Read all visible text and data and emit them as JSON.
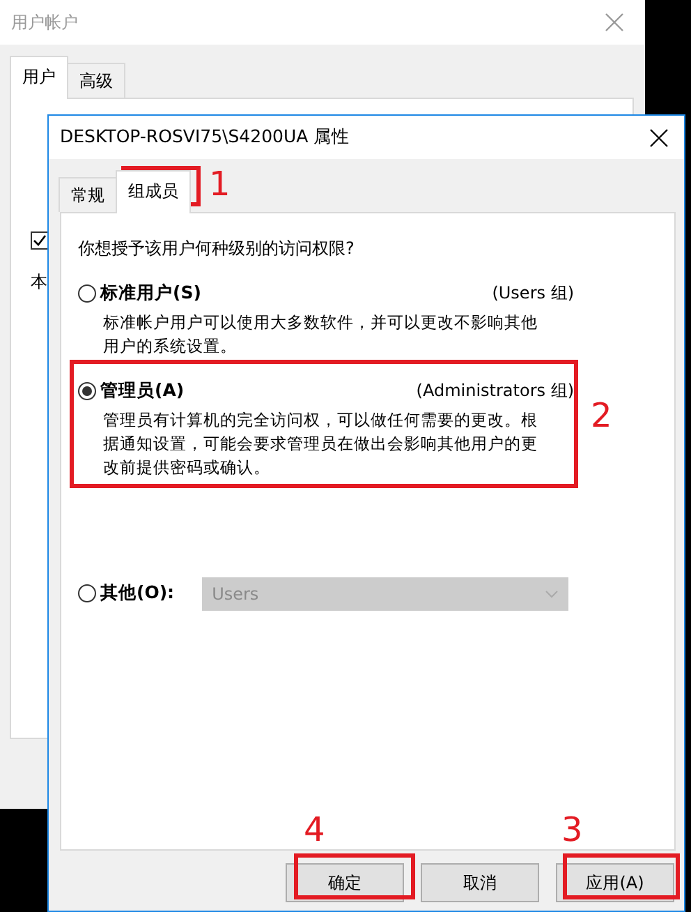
{
  "back_window": {
    "title": "用户帐户",
    "tabs": [
      {
        "label": "用户",
        "selected": true
      },
      {
        "label": "高级",
        "selected": false
      }
    ],
    "checkbox": {
      "checked": true
    },
    "label": "本"
  },
  "dialog": {
    "title": "DESKTOP-ROSVI75\\S4200UA 属性",
    "tabs": [
      {
        "label": "常规",
        "selected": false
      },
      {
        "label": "组成员",
        "selected": true
      }
    ],
    "question": "你想授予该用户何种级别的访问权限?",
    "options": [
      {
        "kind": "group",
        "label": "标准用户(S)",
        "group": "(Users 组)",
        "description": "标准帐户用户可以使用大多数软件，并可以更改不影响其他用户的系统设置。",
        "selected": false
      },
      {
        "kind": "group",
        "label": "管理员(A)",
        "group": "(Administrators 组)",
        "description": "管理员有计算机的完全访问权，可以做任何需要的更改。根据通知设置，可能会要求管理员在做出会影响其他用户的更改前提供密码或确认。",
        "selected": true
      },
      {
        "kind": "dropdown",
        "label": "其他(O):",
        "value": "Users",
        "disabled": true,
        "selected": false
      }
    ],
    "buttons": [
      "确定",
      "取消",
      "应用(A)"
    ]
  },
  "annotations": [
    "1",
    "2",
    "3",
    "4"
  ]
}
